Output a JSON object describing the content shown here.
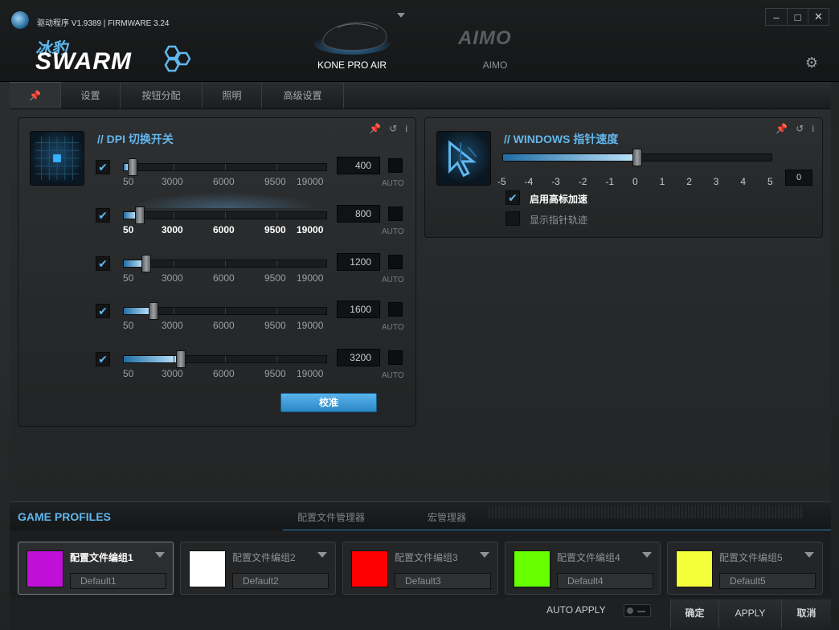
{
  "app": {
    "version_text": "驱动程序 V1.9389 | FIRMWARE 3.24",
    "brand_cn": "冰豹",
    "brand_en": "SWARM"
  },
  "devices": [
    {
      "name": "KONE PRO AIR",
      "selected": true
    },
    {
      "name": "AIMO",
      "logo": "AIMO",
      "selected": false
    }
  ],
  "window_controls": {
    "minimize": "–",
    "maximize": "□",
    "close": "✕"
  },
  "icons": {
    "settings": "gear-icon",
    "pin": "pin-icon",
    "reset": "undo-icon",
    "info": "info-icon"
  },
  "main_tabs": [
    {
      "label": "",
      "icon": "pin-icon",
      "active": true
    },
    {
      "label": "设置"
    },
    {
      "label": "按钮分配"
    },
    {
      "label": "照明"
    },
    {
      "label": "高级设置"
    }
  ],
  "dpi_panel": {
    "title": "// DPI 切换开关",
    "scale_labels": [
      "50",
      "3000",
      "6000",
      "9500",
      "19000"
    ],
    "auto_label": "AUTO",
    "rows": [
      {
        "checked": true,
        "value": "400",
        "fraction": 0.02,
        "active": false
      },
      {
        "checked": true,
        "value": "800",
        "fraction": 0.06,
        "active": true
      },
      {
        "checked": true,
        "value": "1200",
        "fraction": 0.09,
        "active": false
      },
      {
        "checked": true,
        "value": "1600",
        "fraction": 0.13,
        "active": false
      },
      {
        "checked": true,
        "value": "3200",
        "fraction": 0.27,
        "active": false
      }
    ],
    "calibrate_label": "校准"
  },
  "windows_panel": {
    "title": "// WINDOWS 指针速度",
    "scale_labels": [
      "-5",
      "-4",
      "-3",
      "-2",
      "-1",
      "0",
      "1",
      "2",
      "3",
      "4",
      "5"
    ],
    "value": "0",
    "fraction": 0.5,
    "options": [
      {
        "label": "启用高标加速",
        "checked": true
      },
      {
        "label": "显示指针轨迹",
        "checked": false
      }
    ]
  },
  "profile_tabs": {
    "title": "GAME PROFILES",
    "tabs": [
      "配置文件管理器",
      "宏管理器"
    ]
  },
  "profiles": [
    {
      "name": "配置文件编组1",
      "default": "Default1",
      "color": "#c010d8",
      "active": true
    },
    {
      "name": "配置文件编组2",
      "default": "Default2",
      "color": "#ffffff",
      "active": false
    },
    {
      "name": "配置文件编组3",
      "default": "Default3",
      "color": "#ff0000",
      "active": false
    },
    {
      "name": "配置文件编组4",
      "default": "Default4",
      "color": "#66ff00",
      "active": false
    },
    {
      "name": "配置文件编组5",
      "default": "Default5",
      "color": "#f4ff3a",
      "active": false
    }
  ],
  "footer": {
    "auto_apply_label": "AUTO APPLY",
    "ok_label": "确定",
    "apply_label": "APPLY",
    "cancel_label": "取消"
  }
}
